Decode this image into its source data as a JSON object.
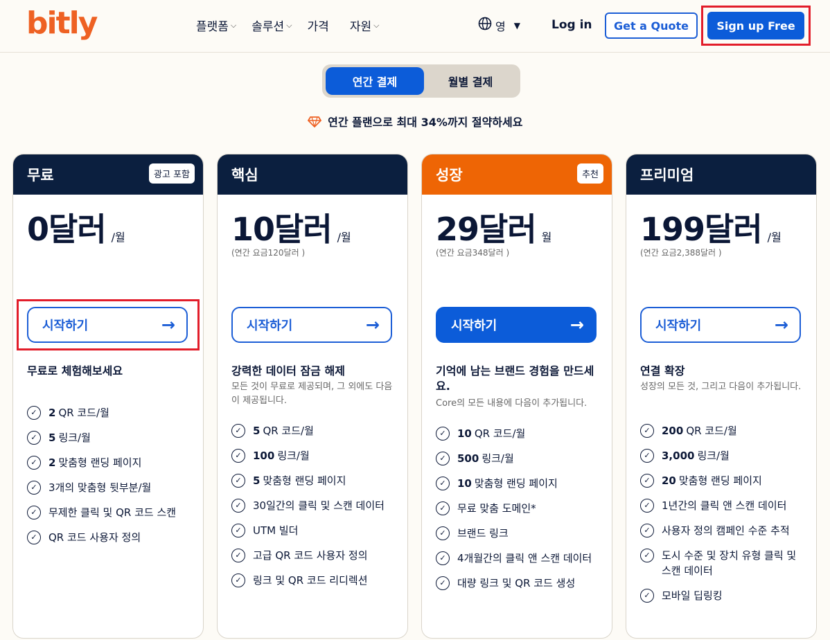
{
  "header": {
    "logo": "bitly",
    "nav": [
      {
        "label": "플랫폼",
        "has_menu": true
      },
      {
        "label": "솔루션",
        "has_menu": true
      },
      {
        "label": "가격",
        "has_menu": false
      },
      {
        "label": "자원",
        "has_menu": true
      }
    ],
    "language": "영",
    "login": "Log in",
    "quote": "Get a Quote",
    "signup": "Sign up Free"
  },
  "billing": {
    "annual": "연간 결제",
    "monthly": "월별 결제",
    "savings": "연간 플랜으로 최대 34%까지 절약하세요"
  },
  "plans": [
    {
      "name": "무료",
      "badge": "광고 포함",
      "price": "0달러",
      "per": "/월",
      "annual": "",
      "cta": "시작하기",
      "tagline": "무료로 체험해보세요",
      "subtag": "",
      "features": [
        {
          "num": "2",
          "text": "QR 코드/월"
        },
        {
          "num": "5",
          "text": "링크/월"
        },
        {
          "num": "2",
          "text": "맞춤형 랜딩 페이지"
        },
        {
          "num": "",
          "text": "3개의 맞춤형 뒷부분/월"
        },
        {
          "num": "",
          "text": "무제한 클릭 및 QR 코드 스캔"
        },
        {
          "num": "",
          "text": "QR 코드 사용자 정의"
        }
      ]
    },
    {
      "name": "핵심",
      "badge": "",
      "price": "10달러",
      "per": "/월",
      "annual": "(연간 요금120달러 )",
      "cta": "시작하기",
      "tagline": "강력한 데이터 잠금 해제",
      "subtag": "모든 것이 무료로 제공되며, 그 외에도 다음이 제공됩니다.",
      "features": [
        {
          "num": "5",
          "text": "QR 코드/월"
        },
        {
          "num": "100",
          "text": "링크/월"
        },
        {
          "num": "5",
          "text": "맞춤형 랜딩 페이지"
        },
        {
          "num": "",
          "text": "30일간의 클릭 및 스캔 데이터"
        },
        {
          "num": "",
          "text": "UTM 빌더"
        },
        {
          "num": "",
          "text": "고급 QR 코드 사용자 정의"
        },
        {
          "num": "",
          "text": "링크 및 QR 코드 리디렉션"
        }
      ]
    },
    {
      "name": "성장",
      "badge": "추천",
      "price": "29달러",
      "per": "월",
      "annual": "(연간 요금348달러 )",
      "cta": "시작하기",
      "tagline": "기억에 남는 브랜드 경험을 만드세요.",
      "subtag": "Core의 모든 내용에 다음이 추가됩니다.",
      "features": [
        {
          "num": "10",
          "text": "QR 코드/월"
        },
        {
          "num": "500",
          "text": "링크/월"
        },
        {
          "num": "10",
          "text": "맞춤형 랜딩 페이지"
        },
        {
          "num": "",
          "text": "무료 맞춤 도메인*"
        },
        {
          "num": "",
          "text": "브랜드 링크"
        },
        {
          "num": "",
          "text": "4개월간의 클릭 앤 스캔 데이터"
        },
        {
          "num": "",
          "text": "대량 링크 및 QR 코드 생성"
        }
      ]
    },
    {
      "name": "프리미엄",
      "badge": "",
      "price": "199달러",
      "per": "/월",
      "annual": "(연간 요금2,388달러 )",
      "cta": "시작하기",
      "tagline": "연결 확장",
      "subtag": "성장의 모든 것, 그리고 다음이 추가됩니다.",
      "features": [
        {
          "num": "200",
          "text": "QR 코드/월"
        },
        {
          "num": "3,000",
          "text": "링크/월"
        },
        {
          "num": "20",
          "text": "맞춤형 랜딩 페이지"
        },
        {
          "num": "",
          "text": "1년간의 클릭 앤 스캔 데이터"
        },
        {
          "num": "",
          "text": "사용자 정의 캠페인 수준 추적"
        },
        {
          "num": "",
          "text": "도시 수준 및 장치 유형 클릭 및 스캔 데이터"
        },
        {
          "num": "",
          "text": "모바일 딥링킹"
        }
      ]
    }
  ],
  "colors": {
    "brand_orange": "#ee6123",
    "primary_blue": "#0c5cd9",
    "navy": "#0b1f3f",
    "highlight_red": "#e21d2a"
  }
}
